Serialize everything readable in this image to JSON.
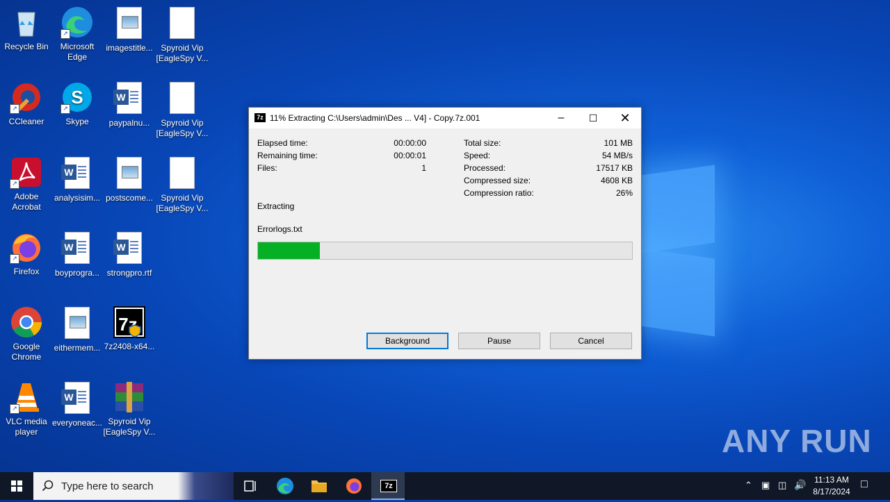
{
  "desktop": {
    "icons": [
      {
        "label": "Recycle Bin"
      },
      {
        "label": "Microsoft Edge"
      },
      {
        "label": "imagestitle..."
      },
      {
        "label": "Spyroid Vip [EagleSpy V..."
      },
      {
        "label": "CCleaner"
      },
      {
        "label": "Skype"
      },
      {
        "label": "paypalnu..."
      },
      {
        "label": "Spyroid Vip [EagleSpy V..."
      },
      {
        "label": "Adobe Acrobat"
      },
      {
        "label": "analysisim..."
      },
      {
        "label": "postscome..."
      },
      {
        "label": "Spyroid Vip [EagleSpy V..."
      },
      {
        "label": "Firefox"
      },
      {
        "label": "boyprogra..."
      },
      {
        "label": "strongpro.rtf"
      },
      {
        "label": "Google Chrome"
      },
      {
        "label": "eithermem..."
      },
      {
        "label": "7z2408-x64..."
      },
      {
        "label": "VLC media player"
      },
      {
        "label": "everyoneac..."
      },
      {
        "label": "Spyroid Vip [EagleSpy V..."
      }
    ]
  },
  "dialog": {
    "title": "11% Extracting C:\\Users\\admin\\Des ... V4] - Copy.7z.001",
    "title_icon": "7z",
    "left": [
      {
        "label": "Elapsed time:",
        "value": "00:00:00"
      },
      {
        "label": "Remaining time:",
        "value": "00:00:01"
      },
      {
        "label": "Files:",
        "value": "1"
      }
    ],
    "right": [
      {
        "label": "Total size:",
        "value": "101 MB"
      },
      {
        "label": "Speed:",
        "value": "54 MB/s"
      },
      {
        "label": "Processed:",
        "value": "17517 KB"
      },
      {
        "label": "Compressed size:",
        "value": "4608 KB"
      },
      {
        "label": "Compression ratio:",
        "value": "26%"
      }
    ],
    "status": "Extracting",
    "current_file": "Errorlogs.txt",
    "progress_percent": 16.5,
    "buttons": {
      "background": "Background",
      "pause": "Pause",
      "cancel": "Cancel"
    }
  },
  "taskbar": {
    "search_placeholder": "Type here to search",
    "active_app_label": "7z",
    "clock_time": "11:13 AM",
    "clock_date": "8/17/2024"
  },
  "watermark": "ANY RUN",
  "colors": {
    "progress": "#06b025",
    "accent": "#0078d7",
    "taskbar": "#101827"
  }
}
